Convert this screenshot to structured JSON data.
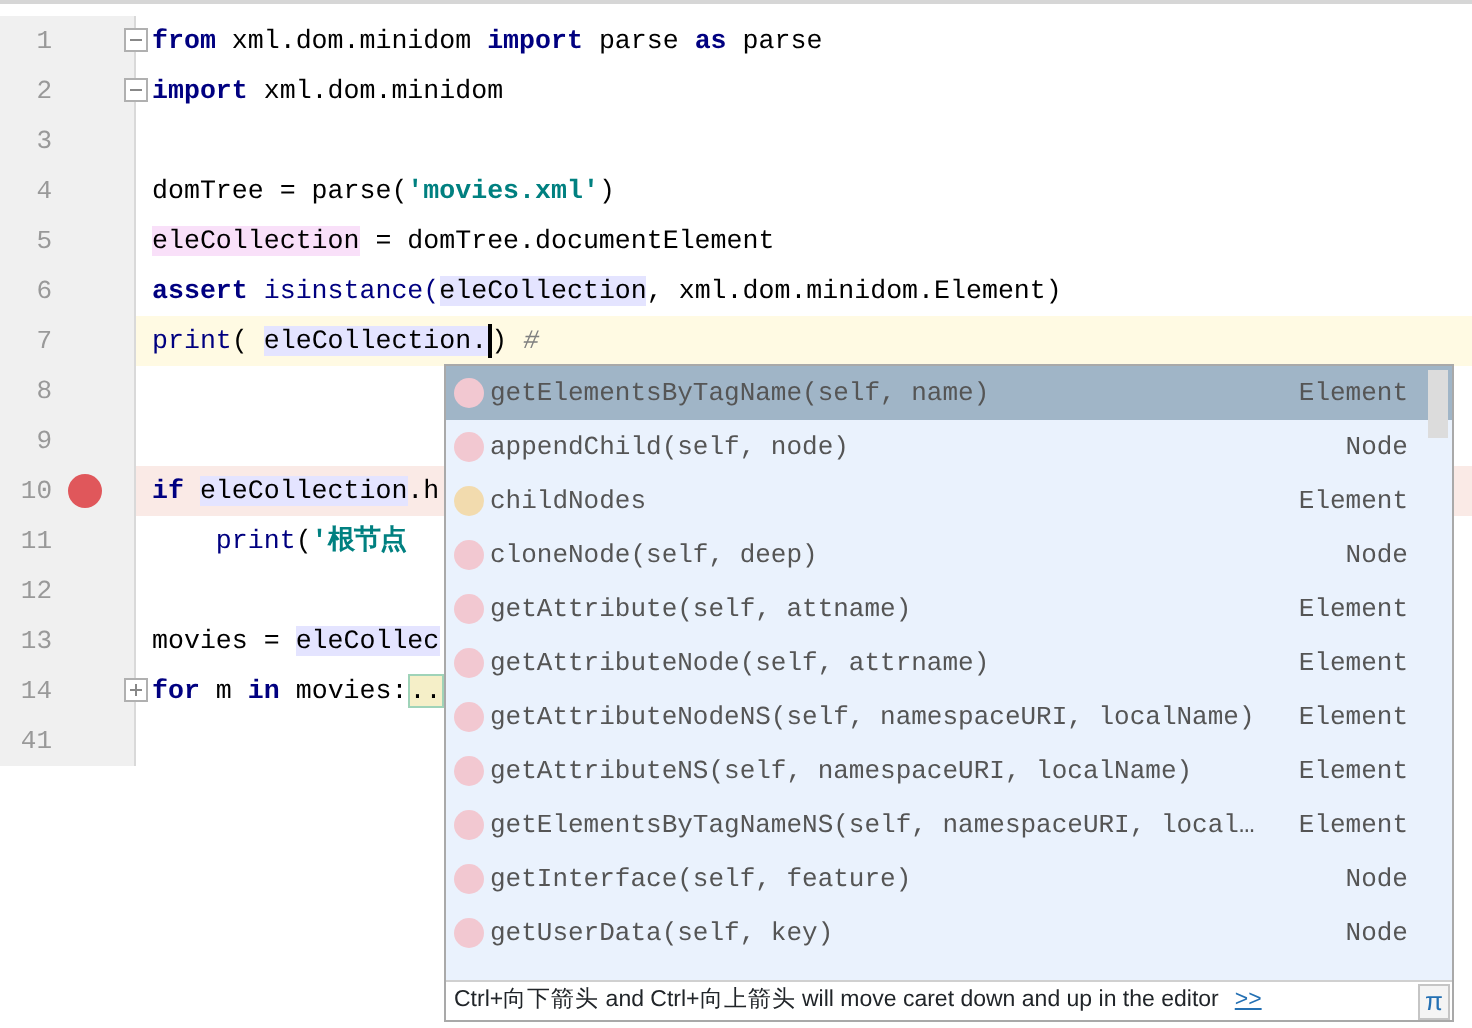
{
  "editor": {
    "lines": [
      {
        "number": "1",
        "fold_marker": true,
        "collapsed": false,
        "tokens": [
          {
            "text": "from",
            "kind": "keyword"
          },
          {
            "text": " xml.dom.minidom ",
            "kind": "plain"
          },
          {
            "text": "import",
            "kind": "keyword"
          },
          {
            "text": " parse ",
            "kind": "plain"
          },
          {
            "text": "as",
            "kind": "keyword"
          },
          {
            "text": " parse",
            "kind": "plain"
          }
        ]
      },
      {
        "number": "2",
        "fold_marker": true,
        "collapsed": false,
        "tokens": [
          {
            "text": "import",
            "kind": "keyword"
          },
          {
            "text": " xml.dom.minidom",
            "kind": "plain"
          }
        ]
      },
      {
        "number": "3"
      },
      {
        "number": "4",
        "tokens": [
          {
            "text": "domTree = parse(",
            "kind": "plain"
          },
          {
            "text": "'movies.xml'",
            "kind": "string"
          },
          {
            "text": ")",
            "kind": "plain"
          }
        ]
      },
      {
        "number": "5",
        "tokens": [
          {
            "text": "eleCollection",
            "kind": "write-ref"
          },
          {
            "text": " = domTree.documentElement",
            "kind": "plain"
          }
        ]
      },
      {
        "number": "6",
        "tokens": [
          {
            "text": "assert",
            "kind": "keyword"
          },
          {
            "text": " isinstance(",
            "kind": "builtin"
          },
          {
            "text": "eleCollection",
            "kind": "read-ref"
          },
          {
            "text": ", xml.dom.minidom.Element)",
            "kind": "plain"
          }
        ]
      },
      {
        "number": "7",
        "current": true,
        "tokens": [
          {
            "text": "print",
            "kind": "builtin"
          },
          {
            "text": "( ",
            "kind": "plain"
          },
          {
            "text": "eleCollection.",
            "kind": "read-ref"
          },
          {
            "kind": "caret"
          },
          {
            "text": ") ",
            "kind": "plain"
          },
          {
            "text": "#",
            "kind": "comment"
          }
        ]
      },
      {
        "number": "8"
      },
      {
        "number": "9"
      },
      {
        "number": "10",
        "breakpoint": true,
        "tokens": [
          {
            "text": "if",
            "kind": "keyword"
          },
          {
            "text": "eleCollection",
            "kind": "read-ref",
            "space_before": true
          },
          {
            "text": ".h",
            "kind": "plain"
          }
        ]
      },
      {
        "number": "11",
        "tokens": [
          {
            "text": "print",
            "kind": "builtin",
            "indent": true
          },
          {
            "text": "(",
            "kind": "plain"
          },
          {
            "text": "'根节点",
            "kind": "string"
          }
        ]
      },
      {
        "number": "12"
      },
      {
        "number": "13",
        "tokens": [
          {
            "text": "movies = ",
            "kind": "plain"
          },
          {
            "text": "eleCollec",
            "kind": "read-ref"
          }
        ]
      },
      {
        "number": "14",
        "fold_marker": true,
        "collapsed": true,
        "tokens": [
          {
            "text": "for",
            "kind": "keyword"
          },
          {
            "text": " m ",
            "kind": "plain"
          },
          {
            "text": "in",
            "kind": "keyword"
          },
          {
            "text": " movies:",
            "kind": "plain"
          },
          {
            "text": "..",
            "kind": "folded"
          }
        ]
      },
      {
        "number": "41"
      }
    ]
  },
  "completion": {
    "items": [
      {
        "kind": "method",
        "text": "getElementsByTagName(self, name)",
        "type": "Element",
        "selected": true
      },
      {
        "kind": "method",
        "text": "appendChild(self, node)",
        "type": "Node",
        "selected": false
      },
      {
        "kind": "field",
        "text": "childNodes",
        "type": "Element",
        "selected": false
      },
      {
        "kind": "method",
        "text": "cloneNode(self, deep)",
        "type": "Node",
        "selected": false
      },
      {
        "kind": "method",
        "text": "getAttribute(self, attname)",
        "type": "Element",
        "selected": false
      },
      {
        "kind": "method",
        "text": "getAttributeNode(self, attrname)",
        "type": "Element",
        "selected": false
      },
      {
        "kind": "method",
        "text": "getAttributeNodeNS(self, namespaceURI, localName)",
        "type": "Element",
        "selected": false
      },
      {
        "kind": "method",
        "text": "getAttributeNS(self, namespaceURI, localName)",
        "type": "Element",
        "selected": false
      },
      {
        "kind": "method",
        "text": "getElementsByTagNameNS(self, namespaceURI, local…",
        "type": "Element",
        "selected": false
      },
      {
        "kind": "method",
        "text": "getInterface(self, feature)",
        "type": "Node",
        "selected": false
      },
      {
        "kind": "method",
        "text": "getUserData(self, key)",
        "type": "Node",
        "selected": false
      }
    ],
    "hint": "Ctrl+向下箭头 and Ctrl+向上箭头 will move caret down and up in the editor",
    "hint_link": ">>",
    "pi_button": "π"
  }
}
